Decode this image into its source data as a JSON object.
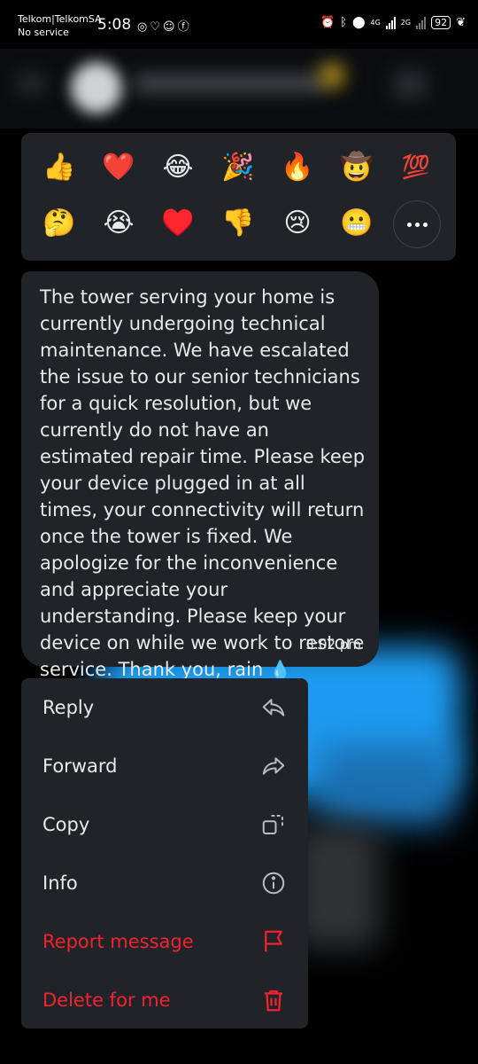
{
  "status_bar": {
    "carrier": "Telkom|TelkomSA",
    "service": "No service",
    "time": "5:08",
    "network": "4G",
    "network2": "2G",
    "battery": "92"
  },
  "reactions": {
    "emojis": [
      "👍",
      "❤️",
      "😂",
      "🎉",
      "🔥",
      "🤠",
      "💯",
      "🤔",
      "😭",
      "♥️",
      "👎",
      "😢",
      "😬"
    ]
  },
  "message": {
    "text": "The tower serving your home is currently undergoing technical maintenance. We have escalated the issue to our senior technicians for a quick resolution, but we currently do not have an estimated repair time. Please keep your device plugged in at all times, your connectivity will return once the tower is fixed. We apologize for the inconvenience and appreciate your understanding. Please keep your device on while we work to restore service. Thank you, rain",
    "emoji": "💧",
    "time": "3:02 pm"
  },
  "menu": {
    "reply": "Reply",
    "forward": "Forward",
    "copy": "Copy",
    "info": "Info",
    "report": "Report message",
    "delete": "Delete for me"
  },
  "colors": {
    "background": "#000000",
    "panel": "#202327",
    "text": "#e7e9ea",
    "danger": "#f4212e"
  }
}
